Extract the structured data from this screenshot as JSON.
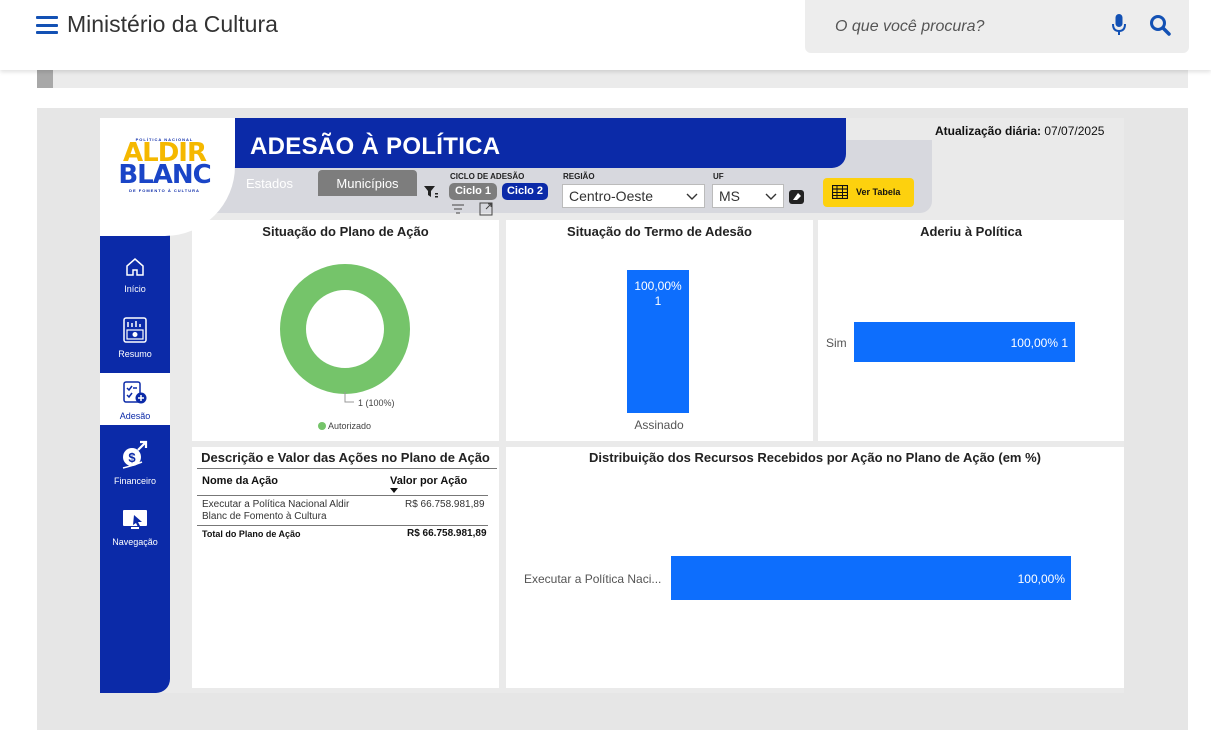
{
  "header": {
    "site_title": "Ministério da Cultura",
    "search_placeholder": "O que você procura?"
  },
  "report": {
    "title": "ADESÃO À POLÍTICA",
    "update_label": "Atualização diária:",
    "update_date": "07/07/2025",
    "logo": {
      "top": "POLÍTICA NACIONAL",
      "line1": "ALDIR",
      "line2": "BLANC",
      "bottom": "DE FOMENTO À CULTURA"
    },
    "tabs": [
      {
        "label": "Estados"
      },
      {
        "label": "Municípios"
      }
    ],
    "filters": {
      "ciclo_label": "CICLO DE ADESÃO",
      "ciclo_1": "Ciclo 1",
      "ciclo_2": "Ciclo 2",
      "regiao_label": "REGIÃO",
      "regiao_value": "Centro-Oeste",
      "uf_label": "UF",
      "uf_value": "MS",
      "ver_tabela": "Ver Tabela"
    },
    "nav": [
      {
        "label": "Início",
        "icon": "home-icon"
      },
      {
        "label": "Resumo",
        "icon": "chart-icon"
      },
      {
        "label": "Adesão",
        "icon": "checklist-icon"
      },
      {
        "label": "Financeiro",
        "icon": "money-icon"
      },
      {
        "label": "Navegação",
        "icon": "monitor-icon"
      }
    ],
    "colors": {
      "brand_blue": "#0b2aa8",
      "bar_blue": "#0d6efd",
      "donut_green": "#75c46a",
      "yellow": "#fdd10e"
    }
  },
  "panels": {
    "plano": {
      "title": "Situação do Plano de Ação",
      "data_label": "1 (100%)",
      "legend": "Autorizado"
    },
    "termo": {
      "title": "Situação do Termo de Adesão",
      "percent_label": "100,00%",
      "count_label": "1",
      "category": "Assinado"
    },
    "aderiu": {
      "title": "Aderiu à Política",
      "category": "Sim",
      "data_label": "100,00% 1"
    },
    "tabela": {
      "title": "Descrição e Valor das Ações no Plano de Ação",
      "col_nome": "Nome da Ação",
      "col_valor": "Valor por Ação",
      "row_nome_1": "Executar a Política Nacional Aldir",
      "row_nome_2": "Blanc de Fomento à Cultura",
      "row_valor": "R$ 66.758.981,89",
      "total_label": "Total do Plano de Ação",
      "total_valor": "R$ 66.758.981,89"
    },
    "distribuicao": {
      "title": "Distribuição dos Recursos Recebidos por Ação no Plano de Ação (em %)",
      "category": "Executar a Política Naci...",
      "data_label": "100,00%"
    }
  },
  "chart_data": [
    {
      "type": "pie",
      "title": "Situação do Plano de Ação",
      "categories": [
        "Autorizado"
      ],
      "values": [
        1
      ],
      "percent": [
        100
      ],
      "donut": true
    },
    {
      "type": "bar",
      "title": "Situação do Termo de Adesão",
      "categories": [
        "Assinado"
      ],
      "values": [
        1
      ],
      "percent": [
        100.0
      ]
    },
    {
      "type": "bar",
      "orientation": "horizontal",
      "title": "Aderiu à Política",
      "categories": [
        "Sim"
      ],
      "values": [
        1
      ],
      "percent": [
        100.0
      ]
    },
    {
      "type": "bar",
      "orientation": "horizontal",
      "title": "Distribuição dos Recursos Recebidos por Ação no Plano de Ação (em %)",
      "categories": [
        "Executar a Política Naci..."
      ],
      "values": [
        100.0
      ]
    }
  ]
}
